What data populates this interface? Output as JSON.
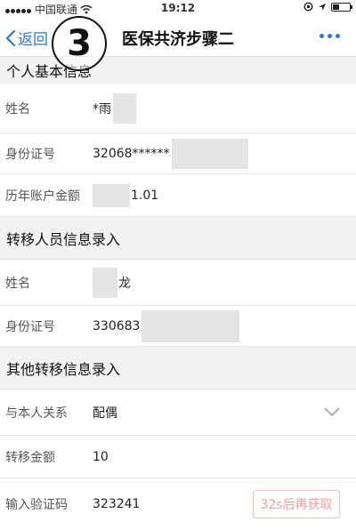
{
  "status": {
    "carrier": "中国联通",
    "time": "19:12",
    "battery_level": 0.4
  },
  "nav": {
    "back_label": "返回",
    "title": "医保共济步骤二"
  },
  "step_badge": "3",
  "sections": {
    "personal": "个人基本信息",
    "transfer_person": "转移人员信息录入",
    "other": "其他转移信息录入"
  },
  "personal": {
    "name_label": "姓名",
    "name_value": "*雨",
    "id_label": "身份证号",
    "id_value": "32068******",
    "balance_label": "历年账户金额",
    "balance_value": "1.01"
  },
  "transfer_person": {
    "name_label": "姓名",
    "name_value": "龙",
    "id_label": "身份证号",
    "id_value": "330683"
  },
  "other": {
    "relation_label": "与本人关系",
    "relation_value": "配偶",
    "amount_label": "转移金额",
    "amount_value": "10",
    "code_label": "输入验证码",
    "code_value": "323241",
    "code_button": "32s后再获取"
  },
  "colors": {
    "accent": "#2a7ad5",
    "code_button": "#f0a0a0"
  }
}
